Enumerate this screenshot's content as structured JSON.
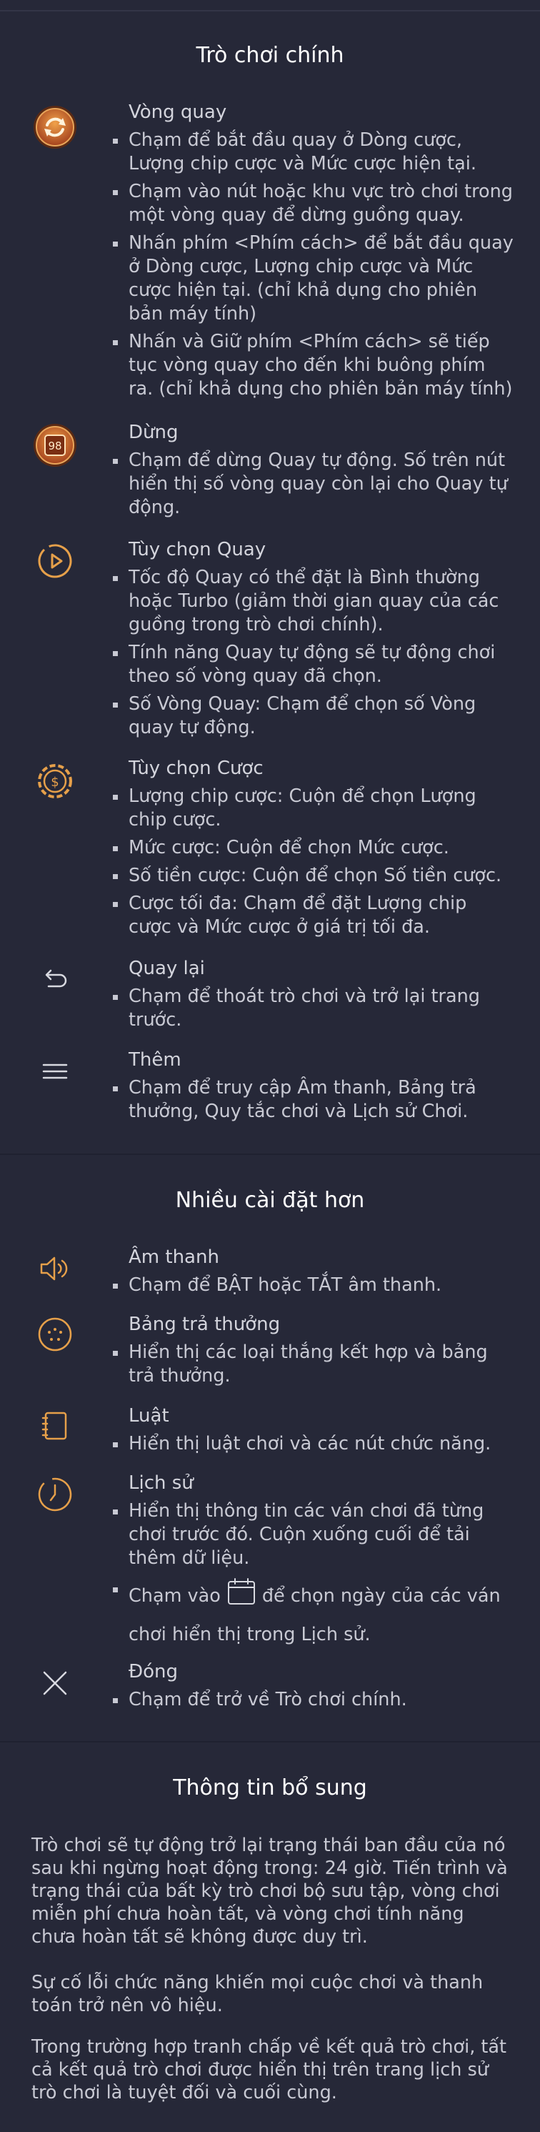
{
  "main": {
    "title": "Trò chơi chính",
    "items": [
      {
        "name": "Vòng quay",
        "icon": "spin-button-icon",
        "bullets": [
          "Chạm để bắt đầu quay ở Dòng cược, Lượng chip cược và Mức cược hiện tại.",
          "Chạm vào nút hoặc khu vực trò chơi trong một vòng quay để dừng guồng quay.",
          "Nhấn phím <Phím cách> để bắt đầu quay ở Dòng cược, Lượng chip cược và Mức cược hiện tại. (chỉ khả dụng cho phiên bản máy tính)",
          "Nhấn và Giữ phím <Phím cách> sẽ tiếp tục vòng quay cho đến khi buông phím ra. (chỉ khả dụng cho phiên bản máy tính)"
        ]
      },
      {
        "name": "Dừng",
        "icon": "stop-autospin-icon",
        "badge": "98",
        "bullets": [
          "Chạm để dừng Quay tự động. Số trên nút hiển thị số vòng quay còn lại cho Quay tự động."
        ]
      },
      {
        "name": "Tùy chọn Quay",
        "icon": "spin-options-icon",
        "bullets": [
          "Tốc độ Quay có thể đặt là Bình thường hoặc Turbo (giảm thời gian quay của các guồng trong trò chơi chính).",
          "Tính năng Quay tự động sẽ tự động chơi theo số vòng quay đã chọn.",
          "Số Vòng Quay: Chạm để chọn số Vòng quay tự động."
        ]
      },
      {
        "name": "Tùy chọn Cược",
        "icon": "bet-options-icon",
        "bullets": [
          "Lượng chip cược: Cuộn để chọn Lượng chip cược.",
          "Mức cược: Cuộn để chọn Mức cược.",
          "Số tiền cược: Cuộn để chọn Số tiền cược.",
          "Cược tối đa: Chạm để đặt Lượng chip cược và Mức cược ở giá trị tối đa."
        ]
      },
      {
        "name": "Quay lại",
        "icon": "back-arrow-icon",
        "bullets": [
          "Chạm để thoát trò chơi và trở lại trang trước."
        ]
      },
      {
        "name": "Thêm",
        "icon": "menu-icon",
        "bullets": [
          "Chạm để truy cập Âm thanh, Bảng trả thưởng, Quy tắc chơi và Lịch sử Chơi."
        ]
      }
    ]
  },
  "more": {
    "title": "Nhiều cài đặt hơn",
    "items": [
      {
        "name": "Âm thanh",
        "icon": "speaker-icon",
        "bullets": [
          "Chạm để BẬT hoặc TẮT âm thanh."
        ]
      },
      {
        "name": "Bảng trả thưởng",
        "icon": "paytable-icon",
        "bullets": [
          "Hiển thị các loại thắng kết hợp và bảng trả thưởng."
        ]
      },
      {
        "name": "Luật",
        "icon": "rules-book-icon",
        "bullets": [
          "Hiển thị luật chơi và các nút chức năng."
        ]
      },
      {
        "name": "Lịch sử",
        "icon": "history-clock-icon",
        "bullets": [
          "Hiển thị thông tin các ván chơi đã từng chơi trước đó. Cuộn xuống cuối để tải thêm dữ liệu."
        ],
        "calendar_before": "Chạm vào",
        "calendar_after": "để chọn ngày của các ván",
        "calendar_line2": "chơi hiển thị trong Lịch sử."
      },
      {
        "name": "Đóng",
        "icon": "close-icon",
        "bullets": [
          "Chạm để trở về Trò chơi chính."
        ]
      }
    ]
  },
  "extra": {
    "title": "Thông tin bổ sung",
    "paragraphs": [
      "Trò chơi sẽ tự động trở lại trạng thái ban đầu của nó sau khi ngừng hoạt động trong: 24 giờ. Tiến trình và trạng thái của bất kỳ trò chơi bộ sưu tập, vòng chơi miễn phí chưa hoàn tất, và vòng chơi tính năng chưa hoàn tất sẽ không được duy trì.",
      "Sự cố lỗi chức năng khiến mọi cuộc chơi và thanh toán trở nên vô hiệu.",
      "Trong trường hợp tranh chấp về kết quả trò chơi, tất cả kết quả trò chơi được hiển thị trên trang lịch sử trò chơi là tuyệt đối và cuối cùng."
    ]
  },
  "colors": {
    "background": "#262838",
    "accent": "#e6a04a",
    "title": "#ffffff",
    "text": "#c8c9d3"
  }
}
